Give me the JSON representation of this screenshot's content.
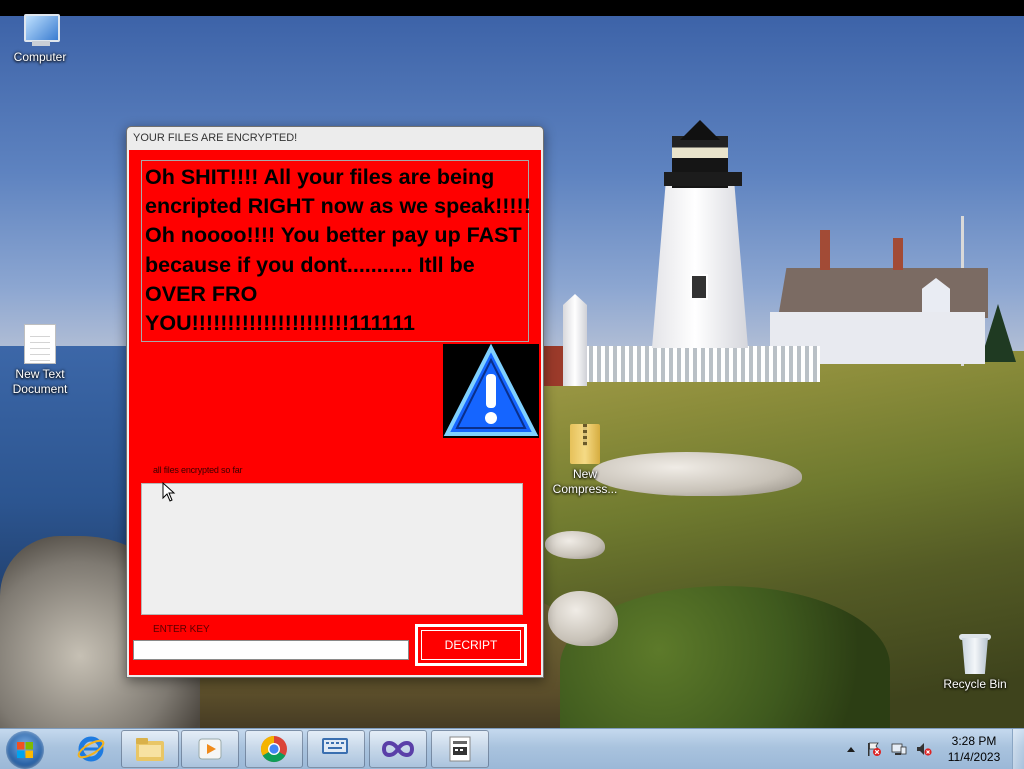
{
  "desktop": {
    "icons": [
      {
        "label": "Computer"
      },
      {
        "label": "New Text Document"
      },
      {
        "label": "New Compress..."
      },
      {
        "label": "Recycle Bin"
      }
    ]
  },
  "ransom_window": {
    "title": "YOUR FILES ARE ENCRYPTED!",
    "message": "Oh SHIT!!!! All your files are being encripted RIGHT now as we speak!!!!! Oh noooo!!!! You better pay up FAST because if you dont........... Itll be OVER FRO YOU!!!!!!!!!!!!!!!!!!!!!!111111",
    "files_label": "all files encrypted so far",
    "files_list": "",
    "key_label": "ENTER KEY",
    "key_value": "",
    "decrypt_label": "DECRIPT"
  },
  "taskbar": {
    "pinned": [
      {
        "icon": "internet-explorer-icon"
      },
      {
        "icon": "file-explorer-icon"
      },
      {
        "icon": "media-player-icon"
      },
      {
        "icon": "chrome-icon"
      },
      {
        "icon": "on-screen-keyboard-icon"
      },
      {
        "icon": "infinity-app-icon"
      },
      {
        "icon": "ransomware-app-icon"
      }
    ],
    "clock": {
      "time": "3:28 PM",
      "date": "11/4/2023"
    }
  },
  "colors": {
    "ransom_bg": "#ff0000",
    "taskbar_bg": "#a9c3de",
    "warning_blue": "#1565ff"
  }
}
